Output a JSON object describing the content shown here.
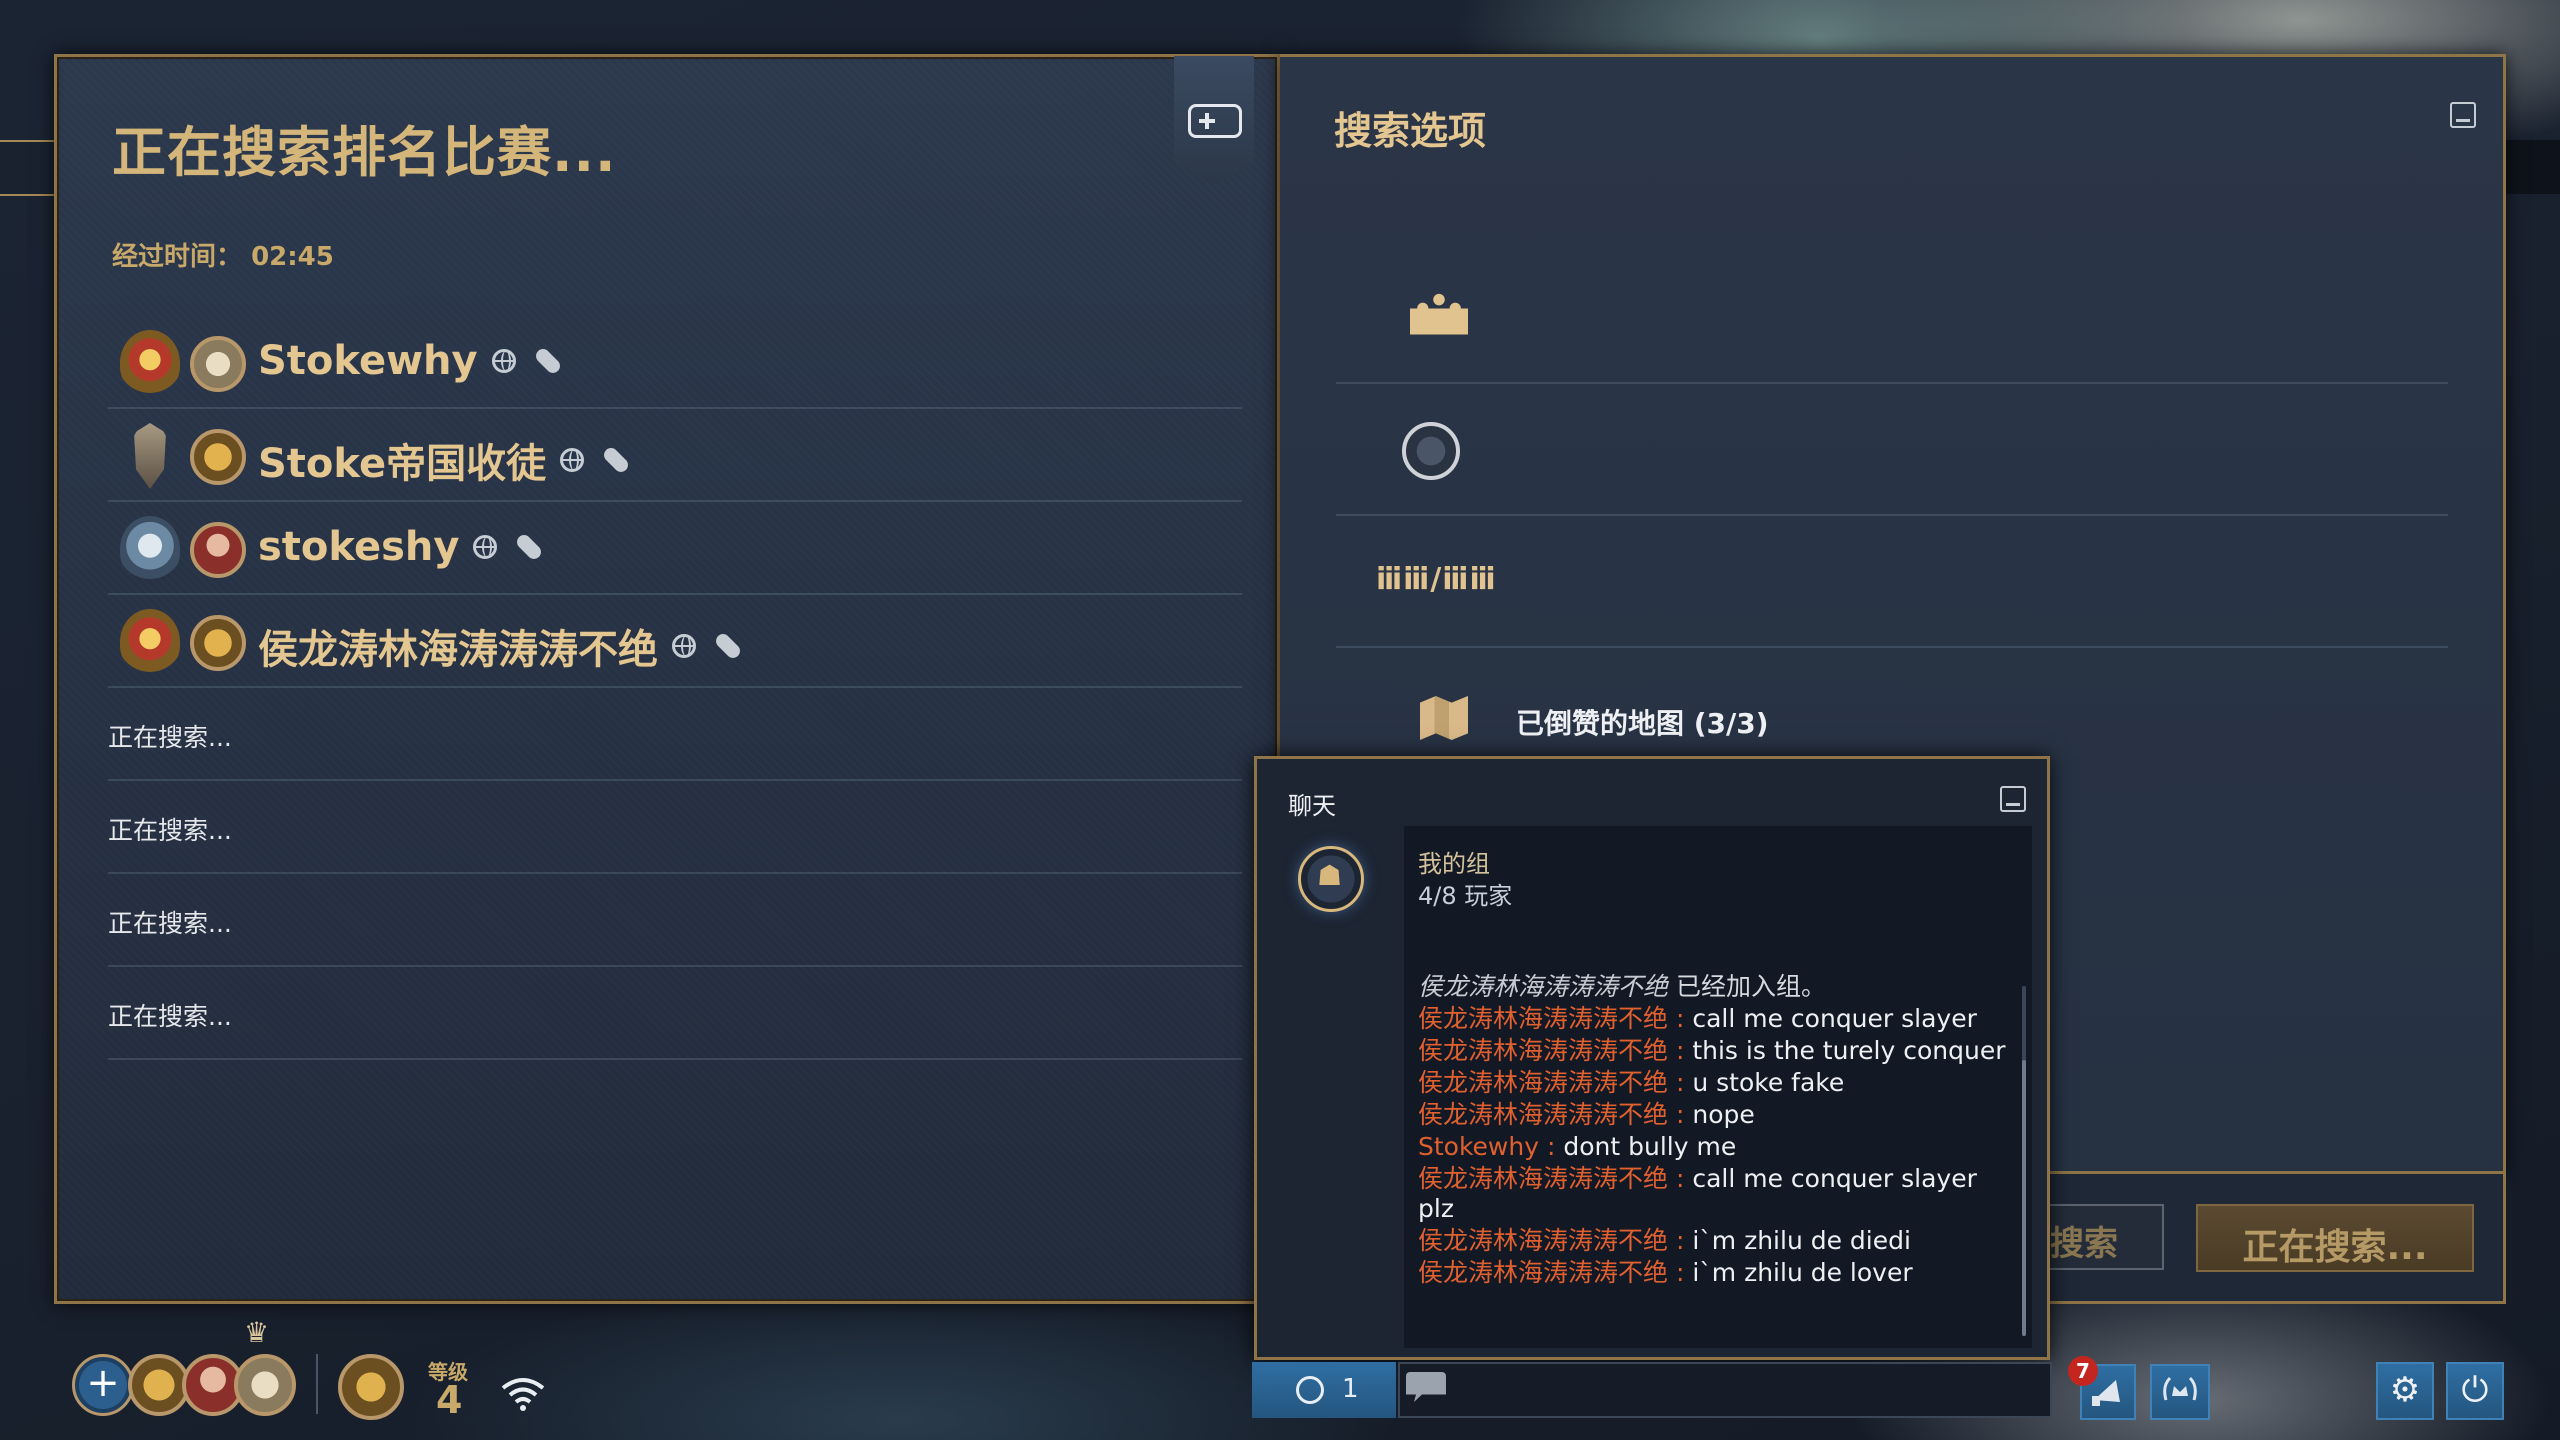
{
  "lobby": {
    "title": "正在搜索排名比赛...",
    "elapsed_label": "经过时间：",
    "elapsed_value": "02:45"
  },
  "players": [
    {
      "name": "Stokewhy"
    },
    {
      "name": "Stoke帝国收徒"
    },
    {
      "name": "stokeshy"
    },
    {
      "name": "侯龙涛林海涛涛涛不绝"
    }
  ],
  "slots": [
    {
      "label": "正在搜索..."
    },
    {
      "label": "正在搜索..."
    },
    {
      "label": "正在搜索..."
    },
    {
      "label": "正在搜索..."
    }
  ],
  "search_options": {
    "title": "搜索选项",
    "army_icon_text": "ⅲⅲ/ⅲⅲ",
    "map_ban_label": "已倒赞的地图 (3/3)",
    "search_button_partial": "搜索",
    "searching_button": "正在搜索..."
  },
  "chat": {
    "title": "聊天",
    "group_name": "我的组",
    "group_count": "4/8 玩家",
    "messages": [
      {
        "who": "侯龙涛林海涛涛涛不绝",
        "sep": "",
        "text": "  已经加入组。",
        "system": true
      },
      {
        "who": "侯龙涛林海涛涛涛不绝",
        "sep": " : ",
        "text": "call me conquer slayer"
      },
      {
        "who": "侯龙涛林海涛涛涛不绝",
        "sep": " : ",
        "text": "this is the turely conquer"
      },
      {
        "who": "侯龙涛林海涛涛涛不绝",
        "sep": " : ",
        "text": "u stoke fake"
      },
      {
        "who": "侯龙涛林海涛涛涛不绝",
        "sep": " : ",
        "text": "nope"
      },
      {
        "who": "Stokewhy",
        "sep": " : ",
        "text": "dont bully me"
      },
      {
        "who": "侯龙涛林海涛涛涛不绝",
        "sep": " : ",
        "text": "call me conquer slayer plz"
      },
      {
        "who": "侯龙涛林海涛涛涛不绝",
        "sep": " : ",
        "text": "i`m zhilu de diedi"
      },
      {
        "who": "侯龙涛林海涛涛涛不绝",
        "sep": " : ",
        "text": "i`m zhilu de lover"
      }
    ],
    "tab_count": "1"
  },
  "bottom_bar": {
    "level_label": "等级",
    "level_value": "4",
    "notification_count": "7",
    "add_label": "+",
    "crown": "♛",
    "settings_glyph": "⚙",
    "power_glyph": "⏻"
  },
  "colors": {
    "gold_text": "#e3c690",
    "panel_border": "#8e7447",
    "chat_name": "#e0602f",
    "button_blue": "#2f6ea3"
  },
  "icons": [
    "input-device-icon",
    "globe-icon",
    "pill-icon",
    "people-icon",
    "shield-swords-icon",
    "army-size-icon",
    "map-icon",
    "minimize-icon",
    "wifi-icon",
    "settings-icon",
    "power-icon",
    "chat-bubble-icon",
    "crown-icon"
  ]
}
